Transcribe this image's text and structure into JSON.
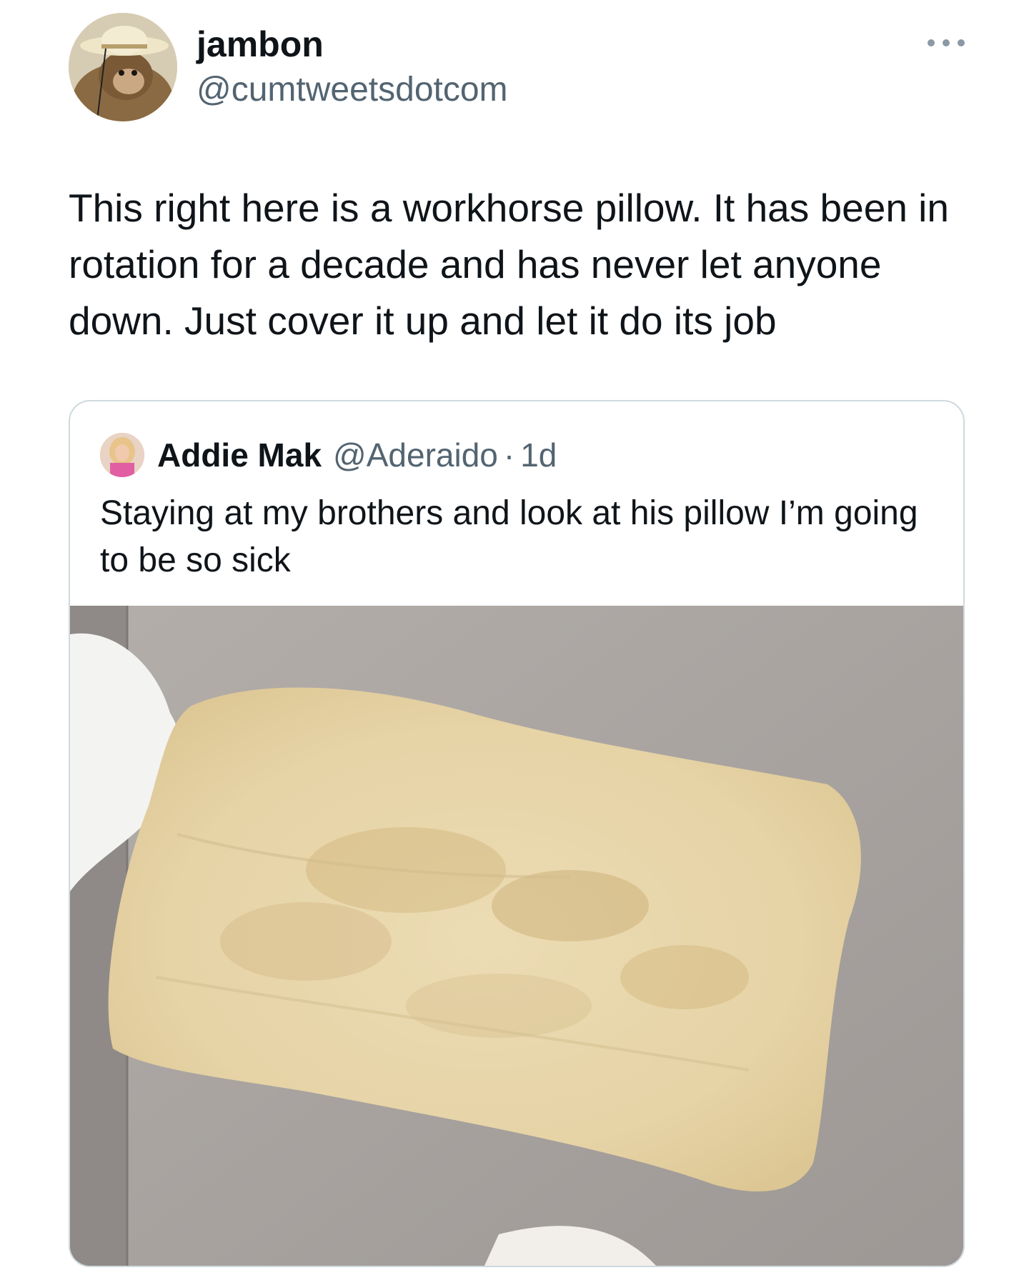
{
  "tweet": {
    "author": {
      "display_name": "jambon",
      "handle": "@cumtweetsdotcom",
      "avatar_icon": "avatar-monkey-with-hat"
    },
    "more_icon": "more-horizontal-icon",
    "text": "This right here is a workhorse pillow. It has been in rotation for a decade and has never let anyone down. Just cover it up and let it do its job"
  },
  "quote": {
    "author": {
      "display_name": "Addie Mak",
      "handle": "@Aderaido",
      "separator": "·",
      "time": "1d",
      "avatar_icon": "avatar-woman-pink"
    },
    "text": "Staying at my brothers and look at his pillow I’m going to be so sick",
    "media": {
      "icon": "photo-stained-pillow-on-couch"
    }
  },
  "colors": {
    "text_primary": "#0f1419",
    "text_secondary": "#536471",
    "border": "#cfd9de",
    "background": "#ffffff"
  }
}
